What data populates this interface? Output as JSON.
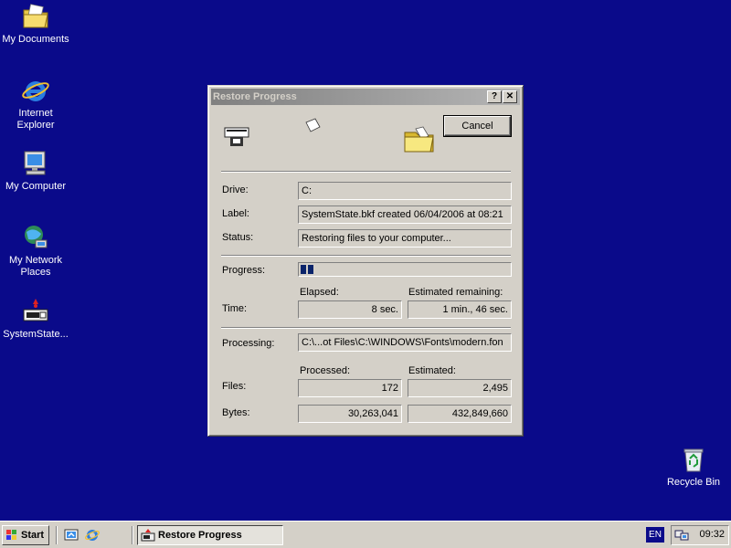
{
  "desktop": {
    "icons": [
      {
        "label": "My Documents",
        "icon": "folder-documents-icon"
      },
      {
        "label": "Internet Explorer",
        "icon": "internet-explorer-icon"
      },
      {
        "label": "My Computer",
        "icon": "computer-icon"
      },
      {
        "label": "My Network Places",
        "icon": "network-places-icon"
      },
      {
        "label": "SystemState...",
        "icon": "backup-file-icon"
      },
      {
        "label": "Recycle Bin",
        "icon": "recycle-bin-icon"
      }
    ]
  },
  "dialog": {
    "title": "Restore Progress",
    "help_button": "?",
    "close_button": "✕",
    "cancel_label": "Cancel",
    "drive_label": "Drive:",
    "drive_value": "C:",
    "label_label": "Label:",
    "label_value": "SystemState.bkf created 06/04/2006 at 08:21",
    "status_label": "Status:",
    "status_value": "Restoring files to your computer...",
    "progress_label": "Progress:",
    "progress_fraction": 0.07,
    "time_label": "Time:",
    "elapsed_header": "Elapsed:",
    "elapsed_value": "8 sec.",
    "remaining_header": "Estimated remaining:",
    "remaining_value": "1 min., 46 sec.",
    "processing_label": "Processing:",
    "processing_value": "C:\\...ot Files\\C:\\WINDOWS\\Fonts\\modern.fon",
    "processed_header": "Processed:",
    "estimated_header": "Estimated:",
    "files_label": "Files:",
    "files_processed": "172",
    "files_estimated": "2,495",
    "bytes_label": "Bytes:",
    "bytes_processed": "30,263,041",
    "bytes_estimated": "432,849,660"
  },
  "taskbar": {
    "start_label": "Start",
    "task_label": "Restore Progress",
    "language": "EN",
    "clock": "09:32"
  }
}
